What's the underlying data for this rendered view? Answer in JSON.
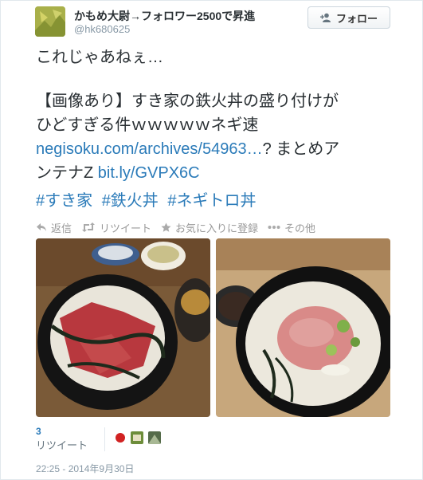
{
  "user": {
    "display_name": "かもめ大尉→フォロワー2500で昇進",
    "screen_name": "@hk680625",
    "follow_label": "フォロー"
  },
  "tweet": {
    "line1": "これじゃあねぇ…",
    "line2": "【画像あり】すき家の鉄火丼の盛り付けが",
    "line3": "ひどすぎる件ｗｗｗｗｗネギ速",
    "link1": "negisoku.com/archives/54963…",
    "line4_rest": "? まとめア",
    "line5_start": "ンテナZ ",
    "link2": "bit.ly/GVPX6C",
    "hashtags": [
      "#すき家",
      "#鉄火丼",
      "#ネギトロ丼"
    ]
  },
  "actions": {
    "reply": "返信",
    "retweet": "リツイート",
    "favorite": "お気に入りに登録",
    "more": "その他"
  },
  "stats": {
    "retweet_count": "3",
    "retweet_label": "リツイート"
  },
  "timestamp": "22:25 - 2014年9月30日",
  "colors": {
    "link": "#2b7bb9",
    "muted": "#999999",
    "border": "#e1e8ed"
  }
}
